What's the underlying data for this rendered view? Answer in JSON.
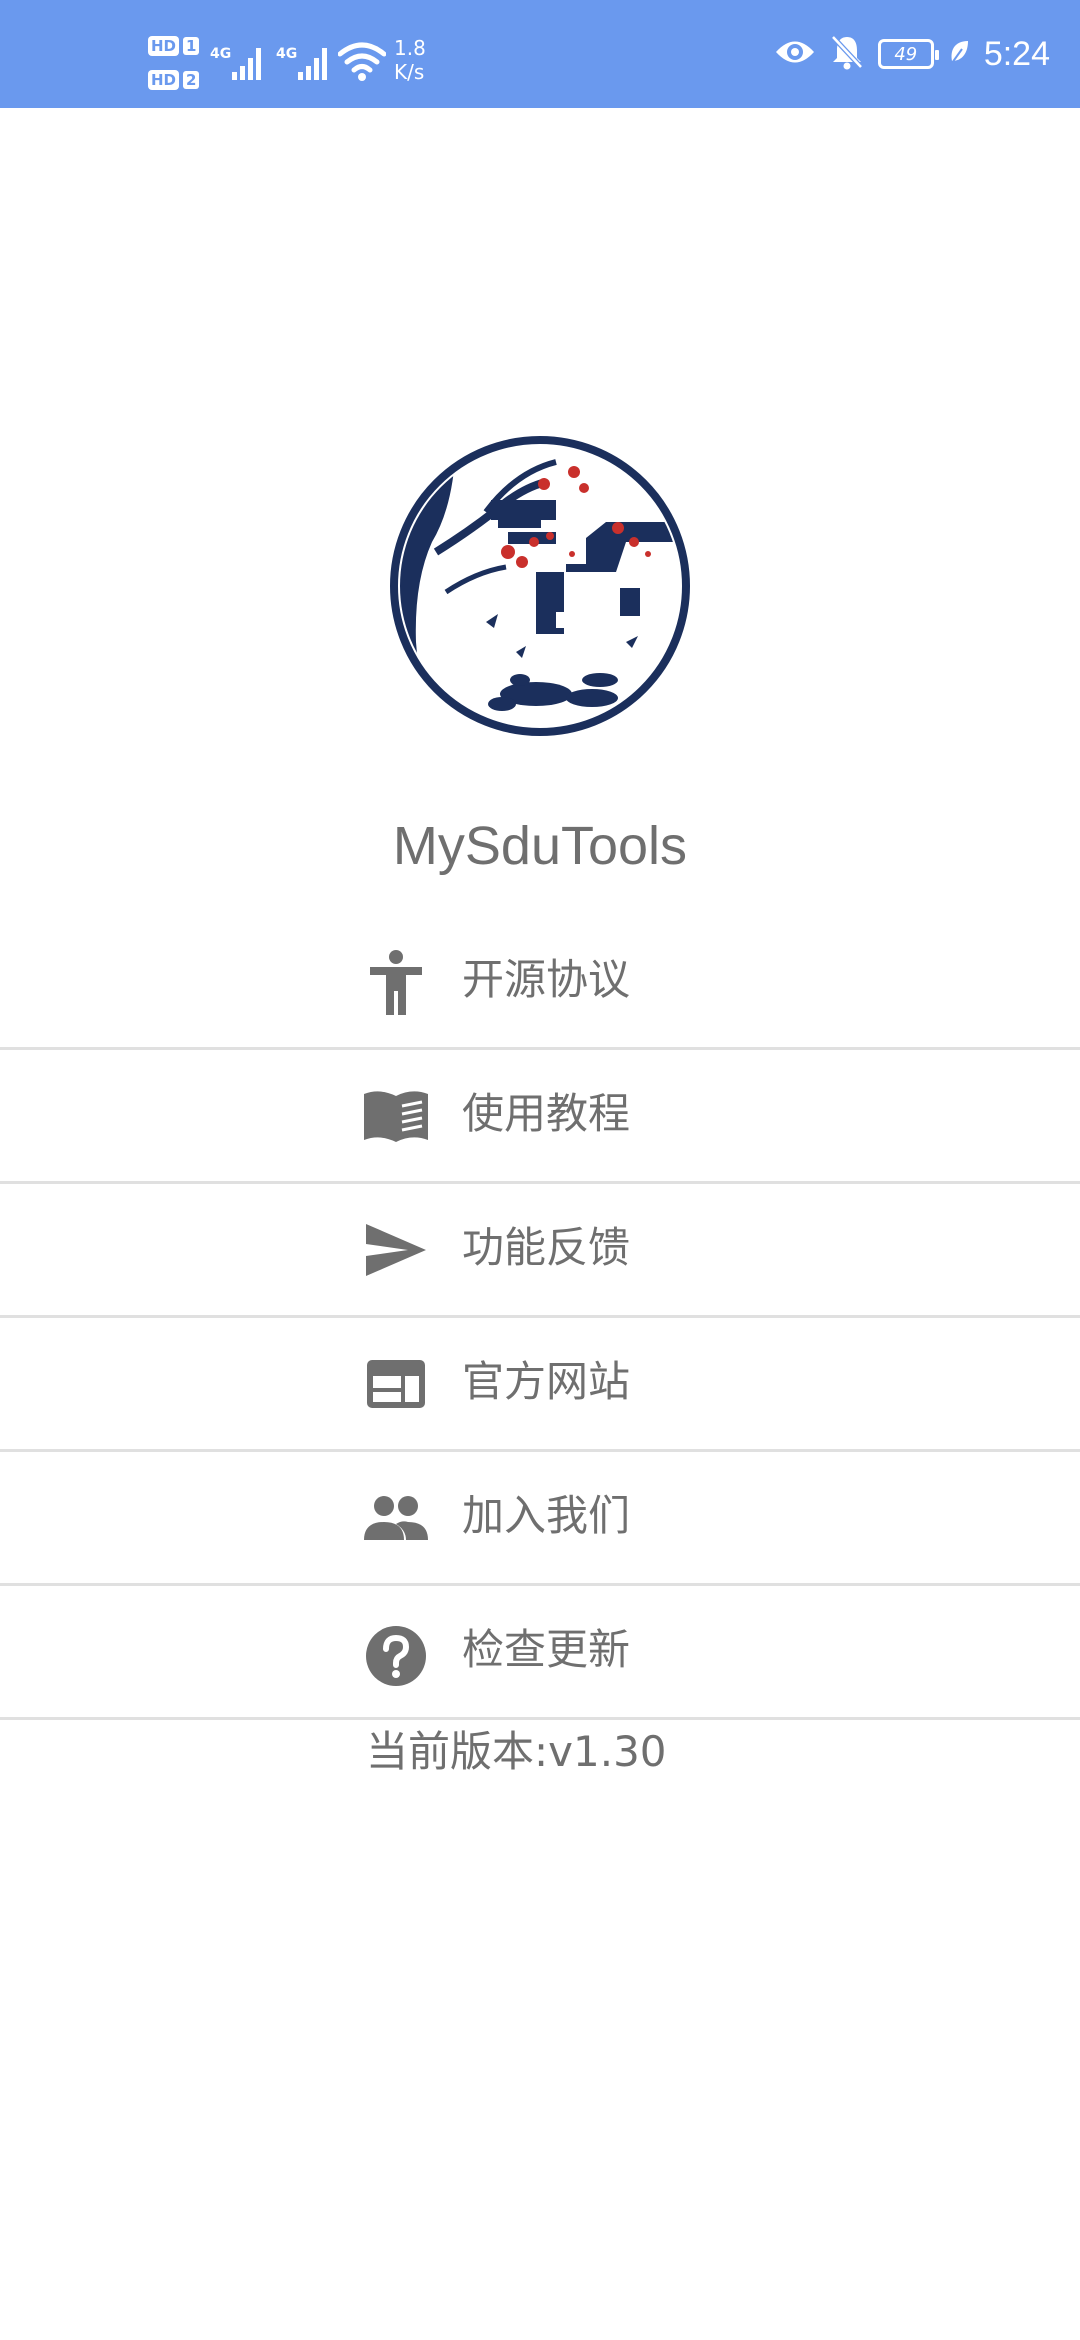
{
  "status_bar": {
    "hd1": "HD",
    "sim1": "1",
    "hd2": "HD",
    "sim2": "2",
    "net1": "4G",
    "net2": "4G",
    "speed_value": "1.8",
    "speed_unit": "K/s",
    "battery": "49",
    "time": "5:24",
    "color": "#6a99ee"
  },
  "app": {
    "name": "MySduTools",
    "logo_icon": "ink-painting-house-plum-logo"
  },
  "menu": {
    "items": [
      {
        "label": "开源协议",
        "icon": "accessibility-person-icon"
      },
      {
        "label": "使用教程",
        "icon": "book-icon"
      },
      {
        "label": "功能反馈",
        "icon": "send-icon"
      },
      {
        "label": "官方网站",
        "icon": "web-window-icon"
      },
      {
        "label": "加入我们",
        "icon": "group-icon"
      },
      {
        "label": "检查更新",
        "icon": "help-circle-icon"
      }
    ]
  },
  "version_text": "当前版本:v1.30"
}
